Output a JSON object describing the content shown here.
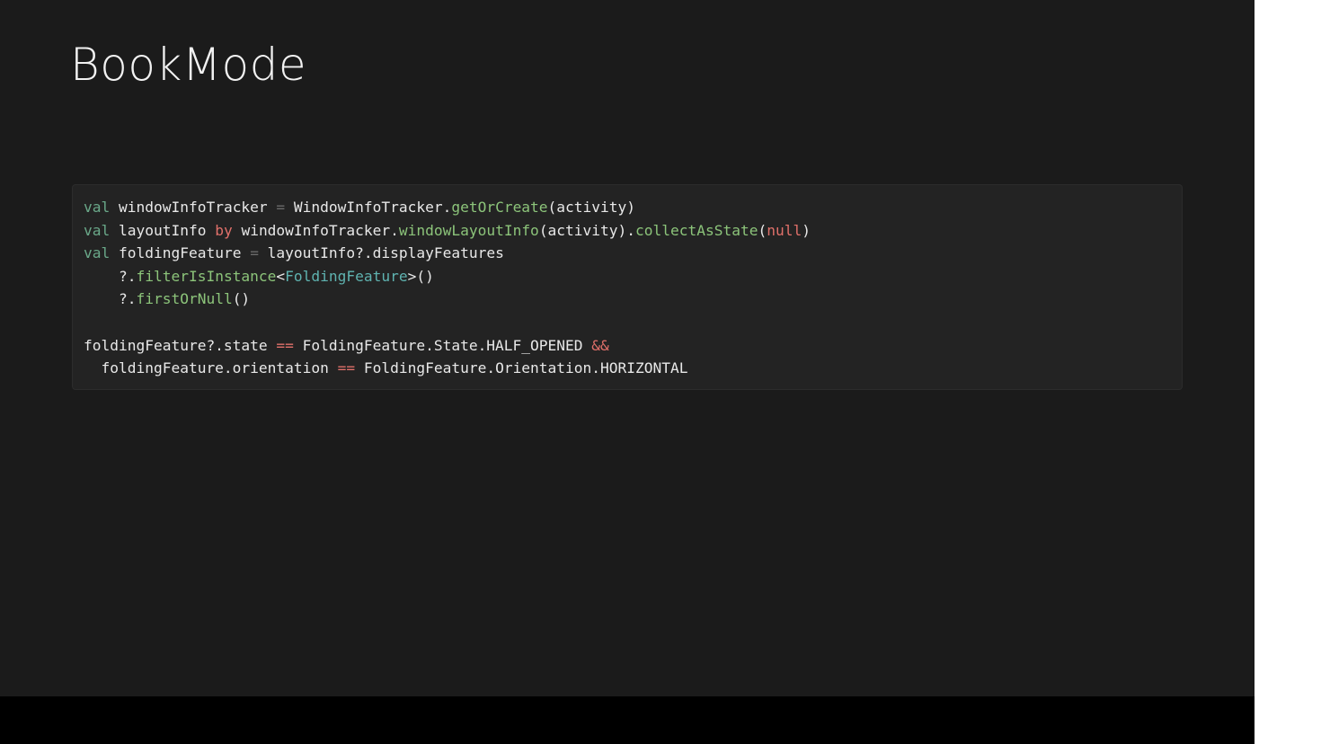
{
  "slide": {
    "title": "BookMode"
  },
  "code": {
    "language": "kotlin",
    "lines": [
      [
        {
          "t": "kw",
          "v": "val"
        },
        {
          "t": "plain",
          "v": " windowInfoTracker "
        },
        {
          "t": "dim",
          "v": "="
        },
        {
          "t": "plain",
          "v": " WindowInfoTracker."
        },
        {
          "t": "fn",
          "v": "getOrCreate"
        },
        {
          "t": "plain",
          "v": "(activity)"
        }
      ],
      [
        {
          "t": "kw",
          "v": "val"
        },
        {
          "t": "plain",
          "v": " layoutInfo "
        },
        {
          "t": "by",
          "v": "by"
        },
        {
          "t": "plain",
          "v": " windowInfoTracker."
        },
        {
          "t": "fn",
          "v": "windowLayoutInfo"
        },
        {
          "t": "plain",
          "v": "(activity)."
        },
        {
          "t": "fn",
          "v": "collectAsState"
        },
        {
          "t": "plain",
          "v": "("
        },
        {
          "t": "nul",
          "v": "null"
        },
        {
          "t": "plain",
          "v": ")"
        }
      ],
      [
        {
          "t": "kw",
          "v": "val"
        },
        {
          "t": "plain",
          "v": " foldingFeature "
        },
        {
          "t": "dim",
          "v": "="
        },
        {
          "t": "plain",
          "v": " layoutInfo?.displayFeatures"
        }
      ],
      [
        {
          "t": "plain",
          "v": "    ?."
        },
        {
          "t": "fn",
          "v": "filterIsInstance"
        },
        {
          "t": "plain",
          "v": "<"
        },
        {
          "t": "type",
          "v": "FoldingFeature"
        },
        {
          "t": "plain",
          "v": ">()"
        }
      ],
      [
        {
          "t": "plain",
          "v": "    ?."
        },
        {
          "t": "fn",
          "v": "firstOrNull"
        },
        {
          "t": "plain",
          "v": "()"
        }
      ],
      [
        {
          "t": "plain",
          "v": ""
        }
      ],
      [
        {
          "t": "plain",
          "v": "foldingFeature?.state "
        },
        {
          "t": "op",
          "v": "=="
        },
        {
          "t": "plain",
          "v": " FoldingFeature.State.HALF_OPENED "
        },
        {
          "t": "op",
          "v": "&&"
        }
      ],
      [
        {
          "t": "plain",
          "v": "  foldingFeature.orientation "
        },
        {
          "t": "op",
          "v": "=="
        },
        {
          "t": "plain",
          "v": " FoldingFeature.Orientation.HORIZONTAL"
        }
      ]
    ]
  },
  "colors": {
    "slide_background": "#1b1b1b",
    "code_background": "#232323",
    "keyword": "#6aa889",
    "function": "#8cc47a",
    "type": "#5fb3b0",
    "operator": "#e0706a",
    "text": "#e8e8e8"
  }
}
